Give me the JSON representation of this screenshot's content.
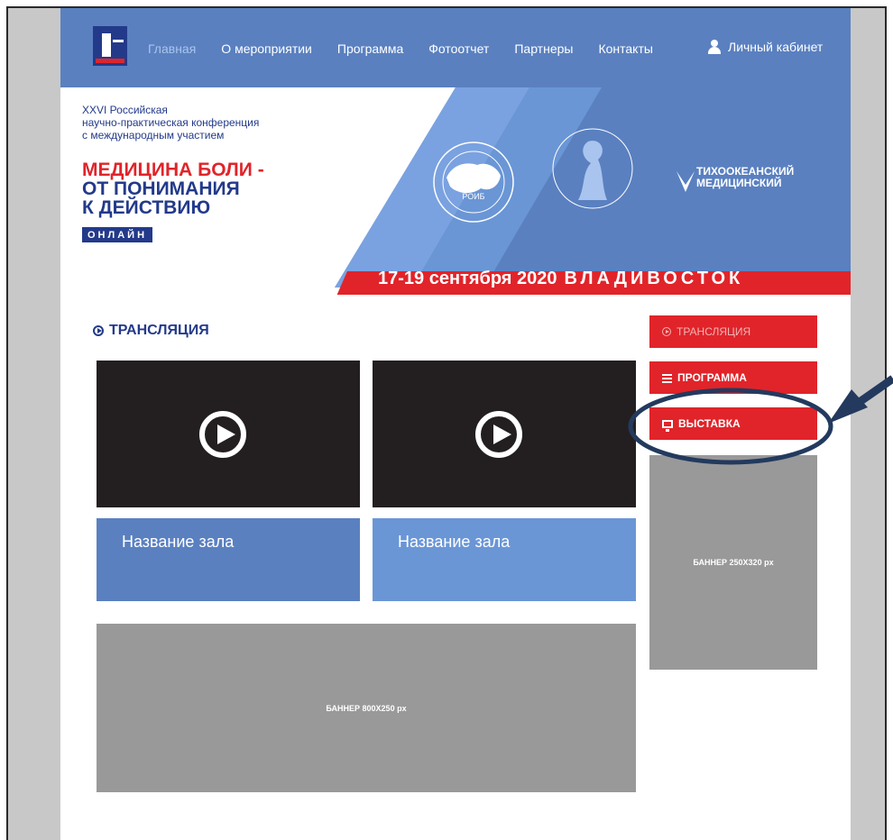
{
  "nav": {
    "items": [
      "Главная",
      "О мероприятии",
      "Программа",
      "Фотоотчет",
      "Партнеры",
      "Контакты"
    ],
    "cabinet": "Личный кабинет"
  },
  "hero": {
    "subtitle_line1": "XXVI Российская",
    "subtitle_line2": "научно-практическая конференция",
    "subtitle_line3": "с международным участием",
    "title_line1": "МЕДИЦИНА БОЛИ -",
    "title_line2": "ОТ ПОНИМАНИЯ",
    "title_line3": "К ДЕЙСТВИЮ",
    "online": "ОНЛАЙН",
    "roib": "РОИБ",
    "tmu_line1": "ТИХООКЕАНСКИЙ",
    "tmu_line2": "МЕДИЦИНСКИЙ",
    "date": "17-19 сентября 2020",
    "city": "ВЛАДИВОСТОК"
  },
  "section": {
    "title": "ТРАНСЛЯЦИЯ"
  },
  "halls": [
    {
      "name": "Название зала",
      "color": "#5a80c0"
    },
    {
      "name": "Название зала",
      "color": "#6a96d6"
    }
  ],
  "side_menu": {
    "translation": "ТРАНСЛЯЦИЯ",
    "program": "ПРОГРАММА",
    "exhibition": "ВЫСТАВКА"
  },
  "banners": {
    "side": "БАННЕР 250X320 px",
    "big": "БАННЕР 800X250 px"
  },
  "colors": {
    "nav_blue": "#5a80c0",
    "dark_blue": "#233a8a",
    "red": "#e0242a",
    "banner_gray": "#999999"
  }
}
